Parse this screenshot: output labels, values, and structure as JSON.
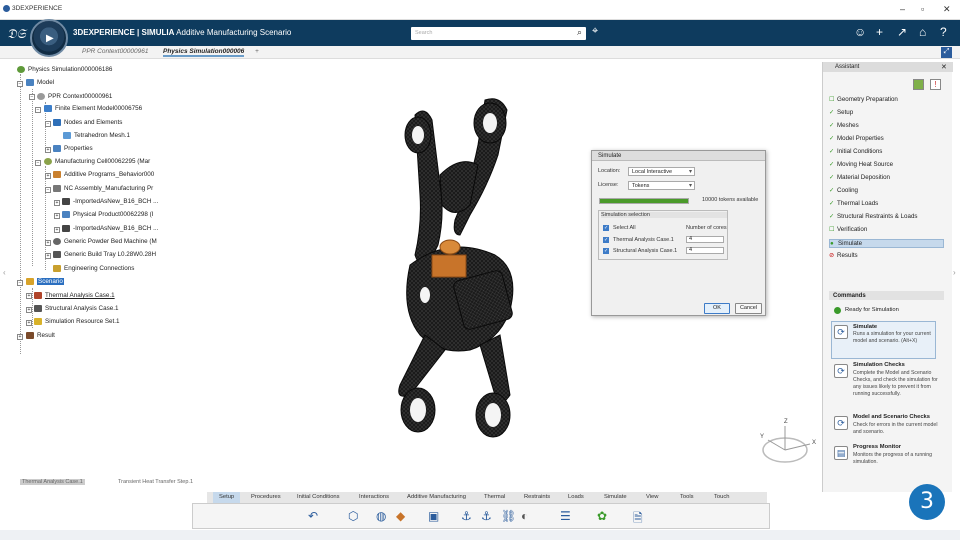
{
  "window": {
    "title": "3DEXPERIENCE",
    "buttons": [
      "–",
      "▫",
      "✕"
    ]
  },
  "appbar": {
    "brand_bold": "3DEXPERIENCE | SIMULIA",
    "brand_rest": " Additive Manufacturing Scenario",
    "search_placeholder": "Search"
  },
  "tabs": [
    {
      "label": "PPR Context00000961",
      "active": false
    },
    {
      "label": "Physics Simulation000006",
      "active": true
    },
    {
      "label": "+",
      "active": false
    }
  ],
  "tree": [
    "Physics Simulation000006186",
    "Model",
    "PPR Context00000961",
    "Finite Element Model00006756",
    "Nodes and Elements",
    "Tetrahedron Mesh.1",
    "Properties",
    "Manufacturing Cell00062295 (Mar",
    "Additive Programs_Behavior000",
    "NC Assembly_Manufacturing Pr",
    "-ImportedAsNew_B16_BCH ...",
    "Physical Product00062298 (I",
    "-ImportedAsNew_B16_BCH ...",
    "Generic Powder Bed Machine (M",
    "Generic Build Tray L0.28W0.28H",
    "Engineering Connections",
    "Scenario",
    "Thermal Analysis Case.1",
    "Structural Analysis Case.1",
    "Simulation Resource Set.1",
    "Result"
  ],
  "dialog": {
    "title": "Simulate",
    "location_label": "Location:",
    "location_value": "Local Interactive",
    "license_label": "License:",
    "license_value": "Tokens",
    "tokens_text": "10000 tokens available",
    "tokens_fill": 1.0,
    "selection_title": "Simulation selection",
    "select_all": "Select All",
    "cores_header": "Number of cores",
    "cases": [
      {
        "name": "Thermal Analysis Case.1",
        "cores": "4"
      },
      {
        "name": "Structural Analysis Case.1",
        "cores": "4"
      }
    ],
    "ok": "OK",
    "cancel": "Cancel"
  },
  "assistant": {
    "title": "Assistant",
    "items": [
      {
        "label": "Geometry Preparation",
        "state": "empty"
      },
      {
        "label": "Setup",
        "state": "done"
      },
      {
        "label": "Meshes",
        "state": "done"
      },
      {
        "label": "Model Properties",
        "state": "done"
      },
      {
        "label": "Initial Conditions",
        "state": "done"
      },
      {
        "label": "Moving Heat Source",
        "state": "done"
      },
      {
        "label": "Material Deposition",
        "state": "done"
      },
      {
        "label": "Cooling",
        "state": "done"
      },
      {
        "label": "Thermal Loads",
        "state": "done"
      },
      {
        "label": "Structural Restraints & Loads",
        "state": "done"
      },
      {
        "label": "Verification",
        "state": "empty"
      },
      {
        "label": "Simulate",
        "state": "active"
      },
      {
        "label": "Results",
        "state": "blocked"
      }
    ],
    "commands_title": "Commands",
    "ready": "Ready for Simulation",
    "commands": [
      {
        "title": "Simulate",
        "desc": "Runs a simulation for your current model and scenario. (Alt+X)"
      },
      {
        "title": "Simulation Checks",
        "desc": "Complete the Model and Scenario Checks, and check the simulation for any issues likely to prevent it from running successfully."
      },
      {
        "title": "Model and Scenario Checks",
        "desc": "Check for errors in the current model and scenario."
      },
      {
        "title": "Progress Monitor",
        "desc": "Monitors the progress of a running simulation."
      }
    ]
  },
  "breadcrumb": {
    "a": "Thermal Analysis Case.1",
    "b": "Transient Heat Transfer Step.1"
  },
  "command_tabs": [
    "Setup",
    "Procedures",
    "Initial Conditions",
    "Interactions",
    "Additive Manufacturing",
    "Thermal",
    "Restraints",
    "Loads",
    "Simulate",
    "View",
    "Tools",
    "Touch"
  ],
  "axes": {
    "x": "X",
    "y": "Y",
    "z": "Z"
  },
  "badge": "3",
  "colors": {
    "appbar": "#0e3b5e",
    "accent": "#1a74ba",
    "ok_green": "#4a9a2a"
  }
}
